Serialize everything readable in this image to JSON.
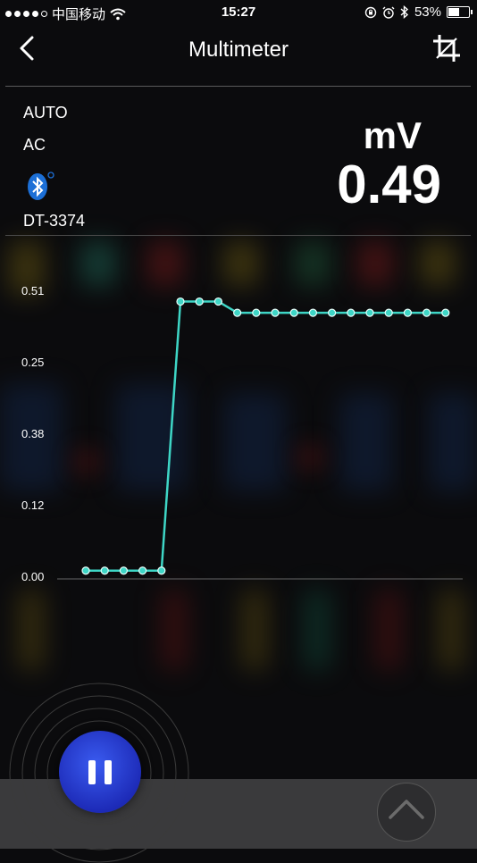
{
  "status_bar": {
    "carrier": "中国移动",
    "time": "15:27",
    "battery_percent": "53%",
    "battery_level": 0.53,
    "icons": [
      "signal-dots-icon",
      "wifi-icon",
      "rotation-lock-icon",
      "alarm-icon",
      "bluetooth-icon",
      "battery-icon"
    ]
  },
  "header": {
    "title": "Multimeter",
    "back_icon": "chevron-left-icon",
    "action_icon": "crop-icon"
  },
  "meter": {
    "range_mode": "AUTO",
    "signal_mode": "AC",
    "connection_icon": "bluetooth-icon",
    "device_name": "DT-3374",
    "unit": "mV",
    "value": "0.49"
  },
  "chart_data": {
    "type": "line",
    "y_tick_labels": [
      "0.51",
      "0.25",
      "0.38",
      "0.12",
      "0.00"
    ],
    "ylim": [
      0,
      0.51
    ],
    "series": [
      {
        "values": [
          0.01,
          0.01,
          0.01,
          0.01,
          0.01,
          0.49,
          0.49,
          0.49,
          0.47,
          0.47,
          0.47,
          0.47,
          0.47,
          0.47,
          0.47,
          0.47,
          0.47,
          0.47,
          0.47,
          0.47
        ]
      }
    ],
    "line_color": "#3ed6c6",
    "grid": false
  },
  "controls": {
    "pause_icon": "pause-icon",
    "expand_icon": "chevron-up-icon"
  },
  "colors": {
    "accent": "#3ed6c6",
    "button": "#2437d0"
  }
}
